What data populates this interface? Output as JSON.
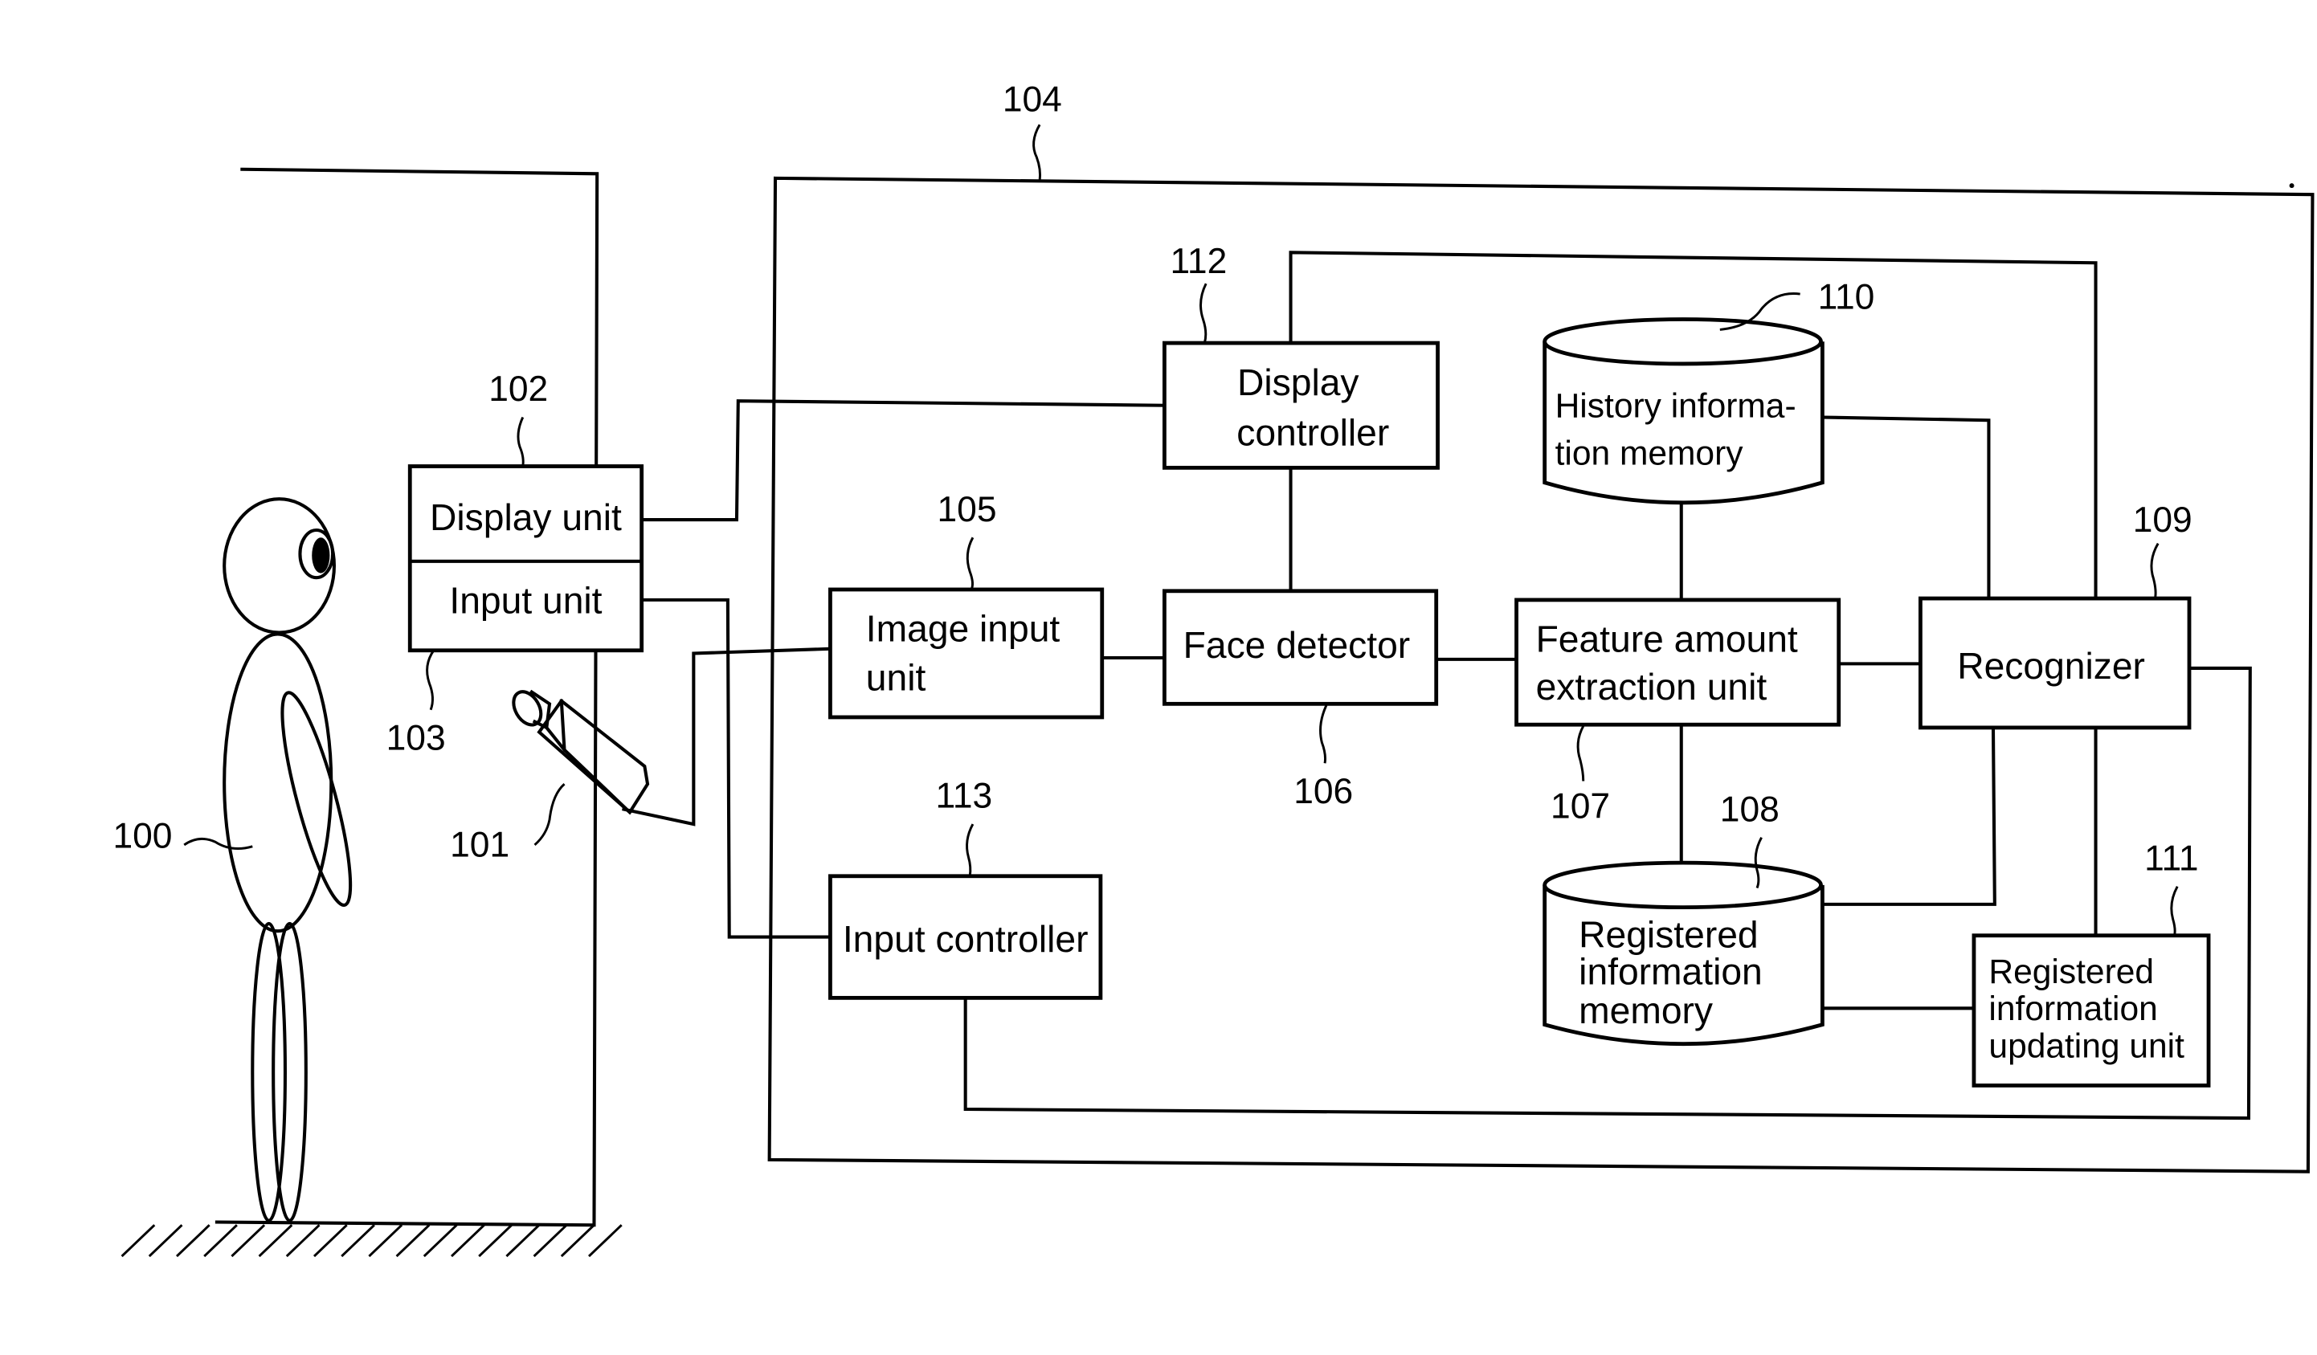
{
  "figure": {
    "type": "block-diagram",
    "subject": "face recognition apparatus"
  },
  "reference_numerals": {
    "person": "100",
    "camera": "101",
    "display_unit": "102",
    "input_unit": "103",
    "processing_unit": "104",
    "image_input_unit": "105",
    "face_detector": "106",
    "feature_extraction_unit": "107",
    "registered_information_memory": "108",
    "recognizer": "109",
    "history_information_memory": "110",
    "registered_information_updating_unit": "111",
    "display_controller": "112",
    "input_controller": "113"
  },
  "blocks": {
    "display_unit": {
      "label": "Display unit"
    },
    "input_unit": {
      "label": "Input unit"
    },
    "display_controller": {
      "lines": [
        "Display",
        "controller"
      ]
    },
    "image_input_unit": {
      "lines": [
        "Image input",
        "unit"
      ]
    },
    "face_detector": {
      "label": "Face detector"
    },
    "feature_extraction_unit": {
      "lines": [
        "Feature amount",
        "extraction unit"
      ]
    },
    "recognizer": {
      "label": "Recognizer"
    },
    "input_controller": {
      "label": "Input controller"
    },
    "history_information_memory": {
      "lines": [
        "History informa-",
        "tion memory"
      ]
    },
    "registered_information_memory": {
      "lines": [
        "Registered",
        "information",
        "memory"
      ]
    },
    "registered_information_updating_unit": {
      "lines": [
        "Registered",
        "information",
        "updating unit"
      ]
    }
  },
  "connections": [
    [
      "display_unit",
      "display_controller"
    ],
    [
      "input_unit",
      "input_controller"
    ],
    [
      "camera",
      "image_input_unit"
    ],
    [
      "image_input_unit",
      "face_detector"
    ],
    [
      "display_controller",
      "face_detector"
    ],
    [
      "face_detector",
      "feature_extraction_unit"
    ],
    [
      "feature_extraction_unit",
      "recognizer"
    ],
    [
      "feature_extraction_unit",
      "history_information_memory"
    ],
    [
      "feature_extraction_unit",
      "registered_information_memory"
    ],
    [
      "history_information_memory",
      "recognizer"
    ],
    [
      "display_controller",
      "recognizer"
    ],
    [
      "recognizer",
      "registered_information_memory"
    ],
    [
      "recognizer",
      "registered_information_updating_unit"
    ],
    [
      "registered_information_memory",
      "registered_information_updating_unit"
    ],
    [
      "recognizer",
      "input_controller"
    ]
  ]
}
